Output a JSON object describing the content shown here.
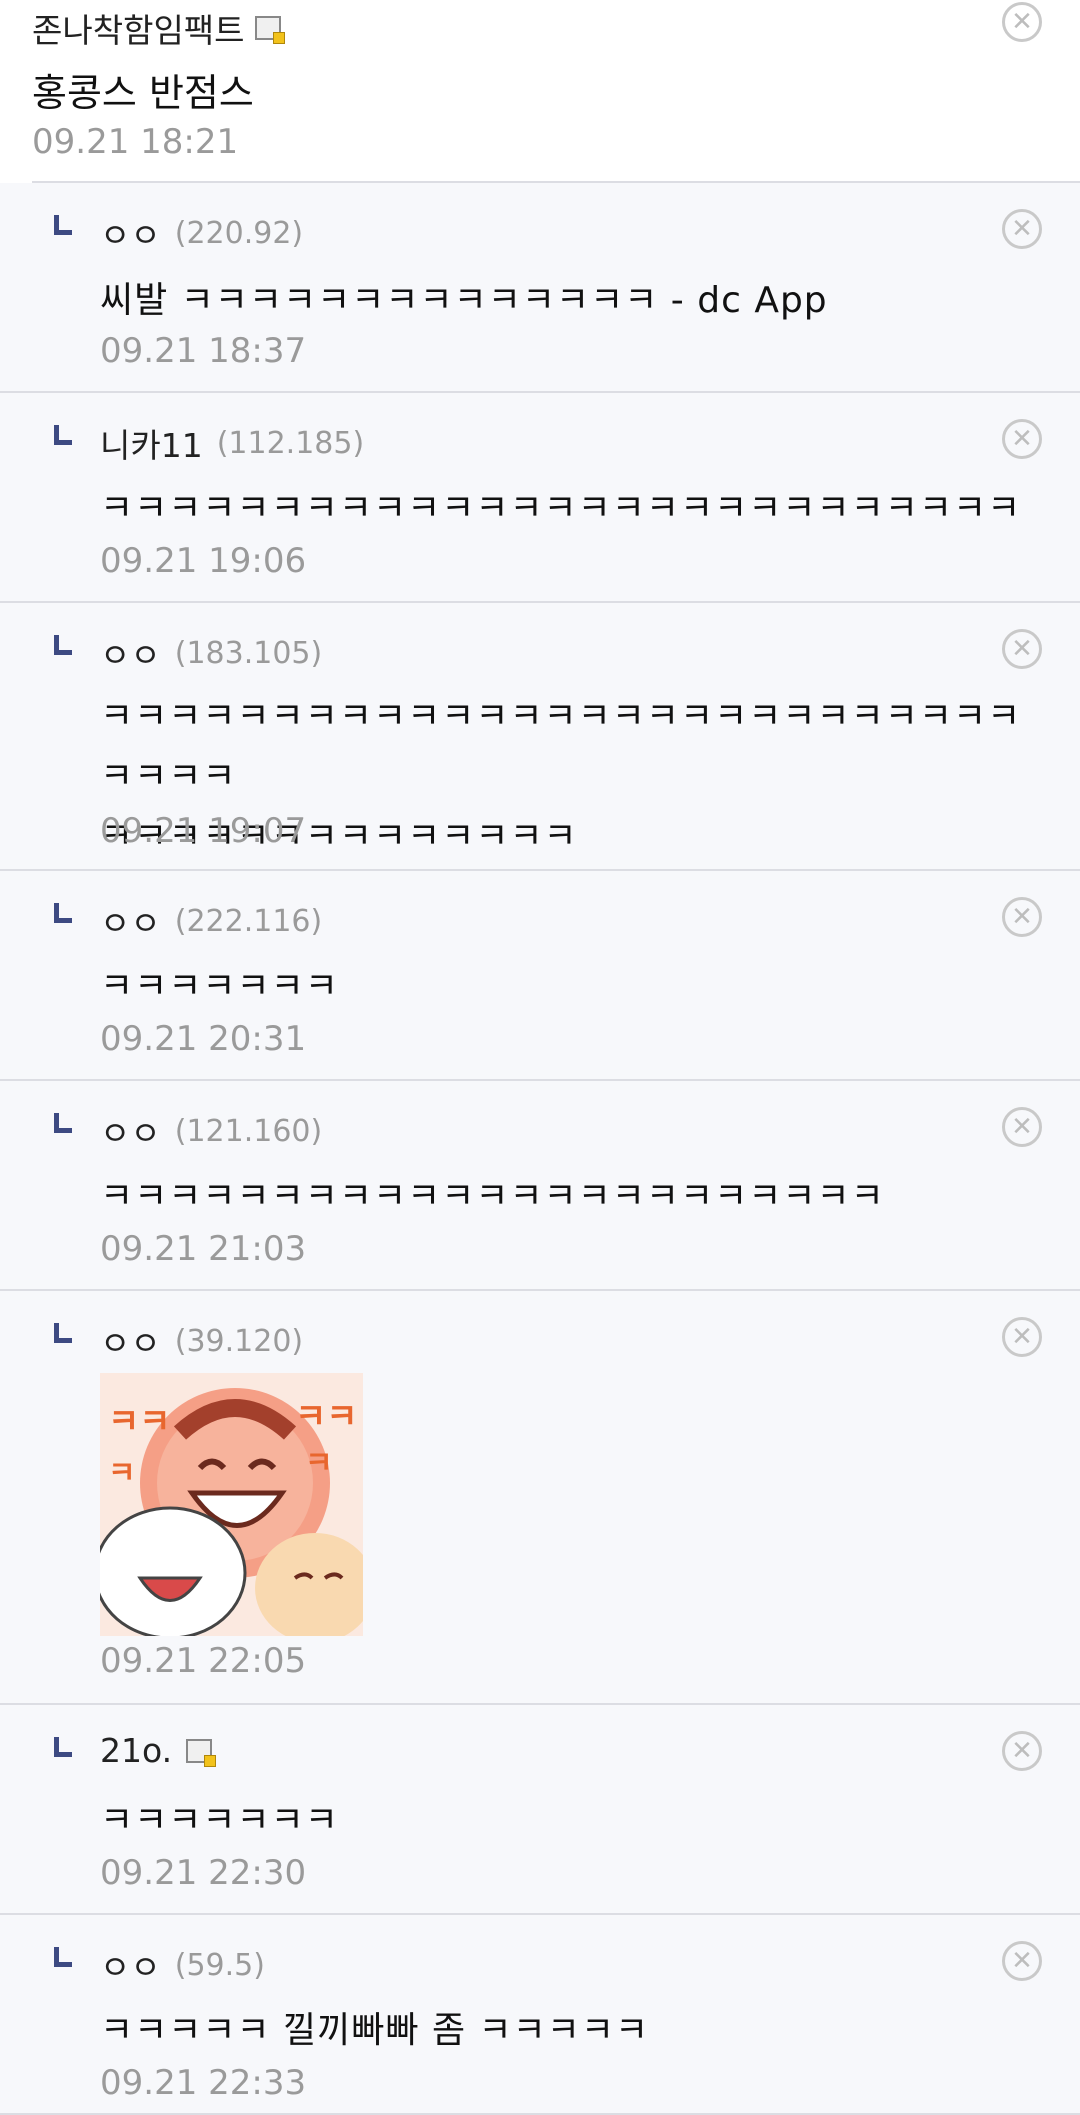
{
  "top_comment": {
    "author": "존나착함임팩트",
    "body": "홍콩스 반점스",
    "time": "09.21 18:21"
  },
  "replies": [
    {
      "nick": "ㅇㅇ",
      "ip": "(220.92)",
      "text": "씨발 ㅋㅋㅋㅋㅋㅋㅋㅋㅋㅋㅋㅋㅋㅋ - dc App",
      "time": "09.21 18:37"
    },
    {
      "nick": "니카11",
      "ip": "(112.185)",
      "text": "ㅋㅋㅋㅋㅋㅋㅋㅋㅋㅋㅋㅋㅋㅋㅋㅋㅋㅋㅋㅋㅋㅋㅋㅋㅋㅋㅋ",
      "time": "09.21 19:06"
    },
    {
      "nick": "ㅇㅇ",
      "ip": "(183.105)",
      "text": "ㅋㅋㅋㅋㅋㅋㅋㅋㅋㅋㅋㅋㅋㅋㅋㅋㅋㅋㅋㅋㅋㅋㅋㅋㅋㅋㅋㅋㅋㅋㅋ\nㅋㅋㅋㅋㅋㅋㅋㅋㅋㅋㅋㅋㅋㅋ",
      "time": "09.21 19:07"
    },
    {
      "nick": "ㅇㅇ",
      "ip": "(222.116)",
      "text": "ㅋㅋㅋㅋㅋㅋㅋ",
      "time": "09.21 20:31"
    },
    {
      "nick": "ㅇㅇ",
      "ip": "(121.160)",
      "text": "ㅋㅋㅋㅋㅋㅋㅋㅋㅋㅋㅋㅋㅋㅋㅋㅋㅋㅋㅋㅋㅋㅋㅋ",
      "time": "09.21 21:03"
    },
    {
      "nick": "ㅇㅇ",
      "ip": "(39.120)",
      "text": "",
      "time": "09.21 22:05"
    },
    {
      "nick": "21o.",
      "ip": "",
      "text": "ㅋㅋㅋㅋㅋㅋㅋ",
      "time": "09.21 22:30"
    },
    {
      "nick": "ㅇㅇ",
      "ip": "(59.5)",
      "text": "ㅋㅋㅋㅋㅋ 낄끼빠빠 좀 ㅋㅋㅋㅋㅋ",
      "time": "09.21 22:33"
    }
  ],
  "icons": {
    "close": "close-icon",
    "reply_arrow": "reply-arrow-icon",
    "gallery": "gallery-icon"
  }
}
